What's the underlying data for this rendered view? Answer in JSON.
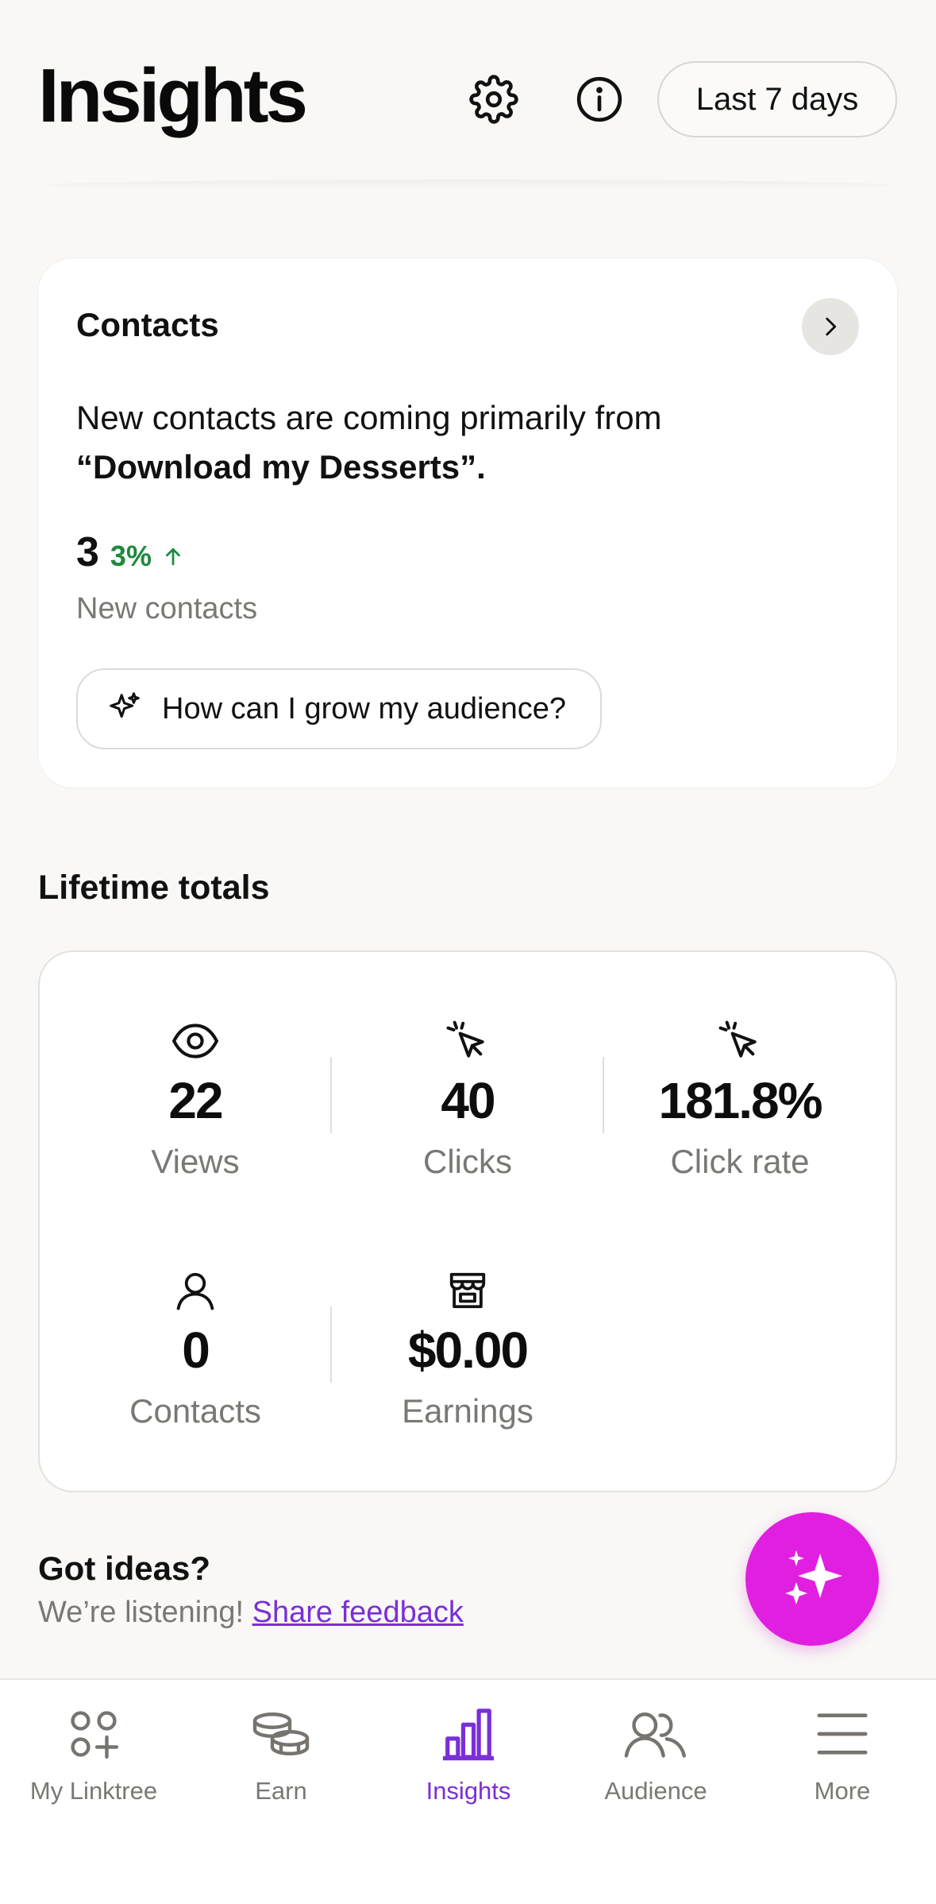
{
  "header": {
    "title": "Insights",
    "range_label": "Last 7 days",
    "settings_icon": "gear-icon",
    "info_icon": "info-icon"
  },
  "contacts_card": {
    "title": "Contacts",
    "summary_prefix": "New contacts are coming primarily from",
    "summary_source": "“Download my Desserts”.",
    "count": "3",
    "delta": "3%",
    "delta_direction": "up",
    "count_label": "New contacts",
    "ask_prompt": "How can I grow my audience?",
    "delta_color": "#1d8a3d"
  },
  "lifetime": {
    "title": "Lifetime totals",
    "metrics": [
      {
        "value": "22",
        "label": "Views",
        "icon": "eye-icon"
      },
      {
        "value": "40",
        "label": "Clicks",
        "icon": "cursor-click-icon"
      },
      {
        "value": "181.8%",
        "label": "Click rate",
        "icon": "cursor-click-icon"
      },
      {
        "value": "0",
        "label": "Contacts",
        "icon": "person-icon"
      },
      {
        "value": "$0.00",
        "label": "Earnings",
        "icon": "store-icon"
      }
    ]
  },
  "feedback": {
    "title": "Got ideas?",
    "prefix": "We’re listening!",
    "link": "Share feedback"
  },
  "fab": {
    "icon": "sparkles-icon",
    "color": "#e11fe0"
  },
  "nav": {
    "items": [
      {
        "label": "My Linktree",
        "icon": "linktree-icon",
        "active": false
      },
      {
        "label": "Earn",
        "icon": "coins-icon",
        "active": false
      },
      {
        "label": "Insights",
        "icon": "bar-chart-icon",
        "active": true
      },
      {
        "label": "Audience",
        "icon": "people-icon",
        "active": false
      },
      {
        "label": "More",
        "icon": "menu-icon",
        "active": false
      }
    ],
    "active_color": "#7b2fd6"
  }
}
